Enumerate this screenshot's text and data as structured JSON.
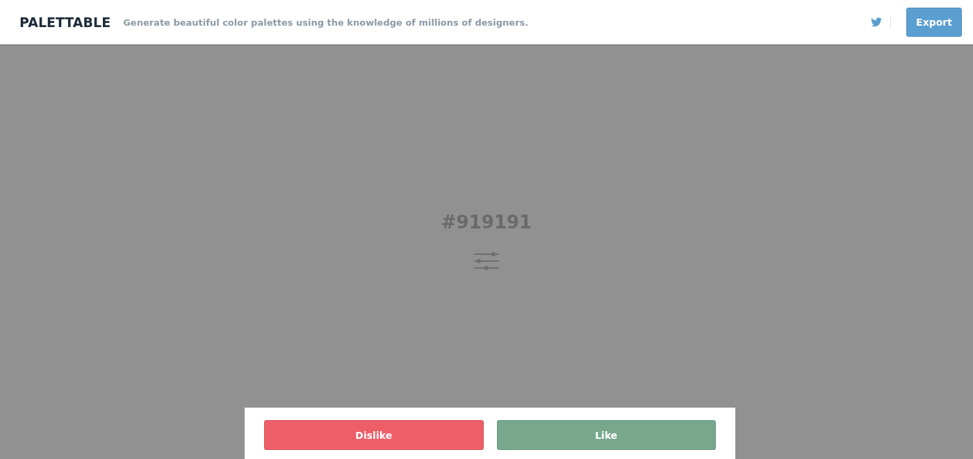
{
  "header": {
    "logo": "PALETTABLE",
    "tagline": "Generate beautiful color palettes using the knowledge of millions of designers.",
    "export_button": "Export"
  },
  "swatch": {
    "hex": "#919191",
    "color": "#919191"
  },
  "actions": [
    {
      "label": "Dislike",
      "kind": "dislike"
    },
    {
      "label": "Like",
      "kind": "like"
    }
  ]
}
